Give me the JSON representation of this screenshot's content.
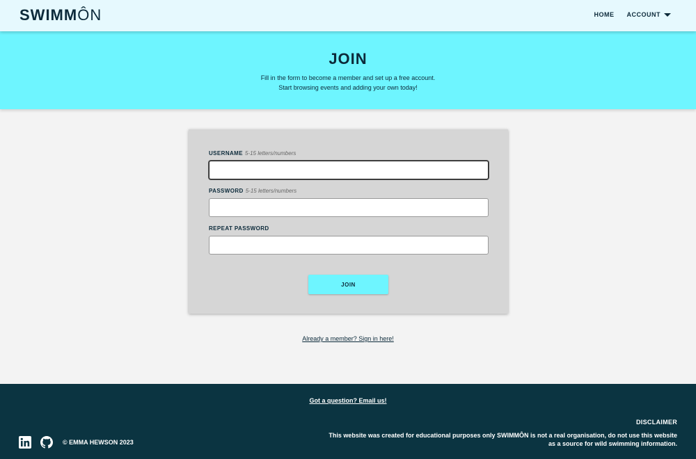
{
  "nav": {
    "logo_bold": "SWIMM",
    "logo_light": "ÔN",
    "links": [
      {
        "label": "HOME"
      },
      {
        "label": "ACCOUNT"
      }
    ]
  },
  "hero": {
    "title": "JOIN",
    "line1": "Fill in the form to become a member and set up a free account.",
    "line2": "Start browsing events and adding your own today!"
  },
  "form": {
    "username_label": "USERNAME",
    "username_hint": "5-15 letters/numbers",
    "username_value": "",
    "password_label": "PASSWORD",
    "password_hint": "5-15 letters/numbers",
    "password_value": "",
    "repeat_label": "REPEAT PASSWORD",
    "repeat_value": "",
    "submit_label": "JOIN"
  },
  "signin_link": "Already a member? Sign in here!",
  "footer": {
    "email_link": "Got a question? Email us!",
    "copyright": "© EMMA HEWSON 2023",
    "disclaimer_title": "DISCLAIMER",
    "disclaimer_line1": "This website was created for educational purposes only SWIMMÔN is not a real organisation, do not use this website",
    "disclaimer_line2": "as a source for wild swimming information.",
    "icons": [
      "linkedin-icon",
      "github-icon"
    ]
  },
  "colors": {
    "accent": "#6ef5ff",
    "navy": "#0b3441",
    "nav_bg": "#e6f9fe"
  }
}
